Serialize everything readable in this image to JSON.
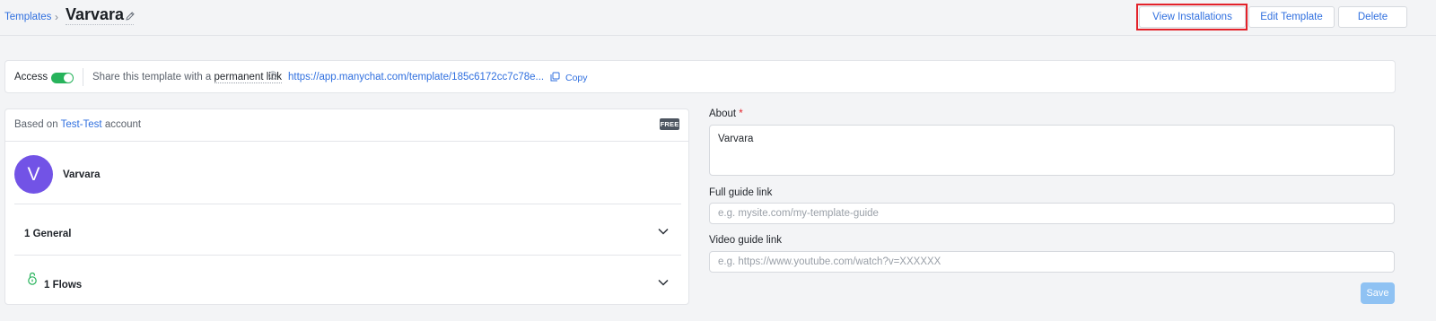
{
  "header": {
    "breadcrumb": "Templates",
    "title": "Varvara",
    "buttons": {
      "view_installations": "View Installations",
      "edit_template": "Edit Template",
      "delete": "Delete"
    }
  },
  "access_bar": {
    "label": "Access",
    "toggle_on": true,
    "share_prefix": "Share this template with a",
    "share_term": "permanent link",
    "link": "https://app.manychat.com/template/185c6172cc7c78e...",
    "copy": "Copy"
  },
  "template_card": {
    "based_prefix": "Based on",
    "account": "Test-Test",
    "based_suffix": "account",
    "badge": "FREE",
    "avatar_letter": "V",
    "name": "Varvara",
    "sections": [
      {
        "label": "1 General"
      },
      {
        "label": "1 Flows"
      }
    ]
  },
  "form": {
    "about_label": "About",
    "about_required": "*",
    "about_value": "Varvara",
    "full_guide_label": "Full guide link",
    "full_guide_placeholder": "e.g. mysite.com/my-template-guide",
    "video_guide_label": "Video guide link",
    "video_guide_placeholder": "e.g. https://www.youtube.com/watch?v=XXXXXX",
    "save": "Save"
  },
  "colors": {
    "link": "#2f6fdf",
    "toggle": "#27b35b",
    "avatar": "#7253e6",
    "highlight": "#e3222a",
    "save_disabled": "#8fc2f3"
  }
}
